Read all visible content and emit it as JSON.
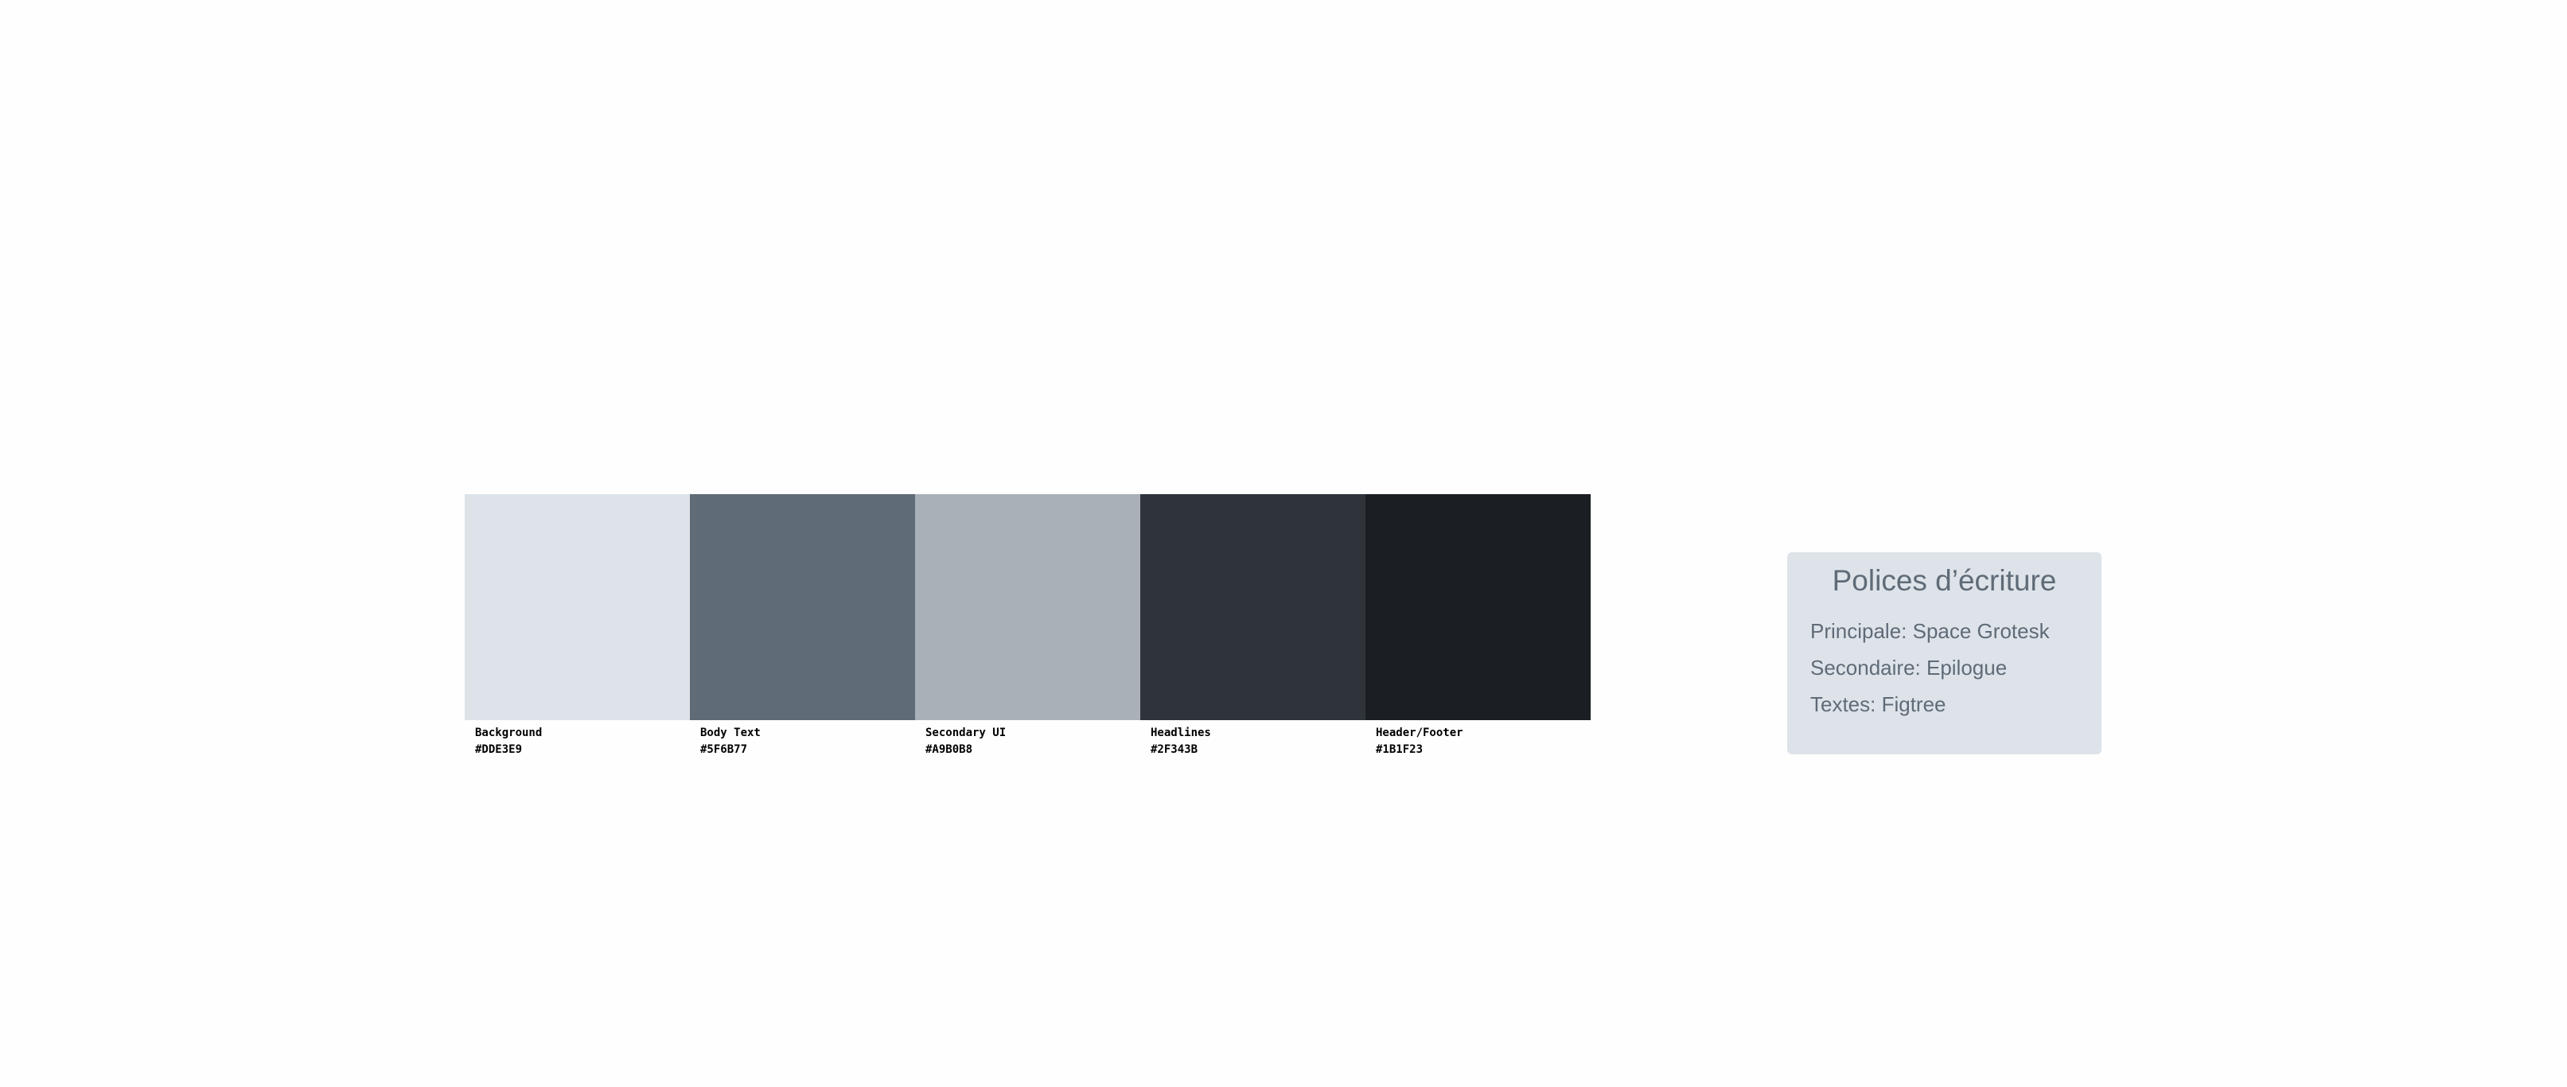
{
  "palette": [
    {
      "name": "Background",
      "hex": "#DDE3E9"
    },
    {
      "name": "Body Text",
      "hex": "#5F6B77"
    },
    {
      "name": "Secondary UI",
      "hex": "#A9B0B8"
    },
    {
      "name": "Headlines",
      "hex": "#2F343B"
    },
    {
      "name": "Header/Footer",
      "hex": "#1B1F23"
    }
  ],
  "fonts_card": {
    "title": "Polices d’écriture",
    "lines": [
      "Principale: Space Grotesk",
      "Secondaire: Epilogue",
      "Textes: Figtree"
    ]
  }
}
